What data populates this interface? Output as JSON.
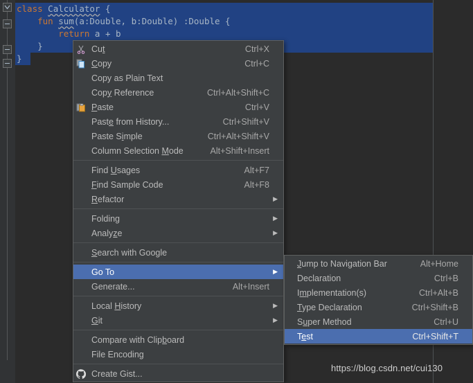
{
  "editor": {
    "lines": [
      {
        "indent": 0,
        "tokens": [
          {
            "t": "class",
            "c": "kw"
          },
          {
            "t": " ",
            "c": "punct"
          },
          {
            "t": "Calculator",
            "c": "ident squig"
          },
          {
            "t": " {",
            "c": "punct"
          }
        ]
      },
      {
        "indent": 1,
        "tokens": [
          {
            "t": "fun",
            "c": "kw"
          },
          {
            "t": " ",
            "c": "punct"
          },
          {
            "t": "sum",
            "c": "ident squig"
          },
          {
            "t": "(a:Double, b:Double) :Double {",
            "c": "punct"
          }
        ]
      },
      {
        "indent": 2,
        "tokens": [
          {
            "t": "return",
            "c": "kw"
          },
          {
            "t": " a + b",
            "c": "punct"
          }
        ]
      },
      {
        "indent": 1,
        "tokens": [
          {
            "t": "}",
            "c": "punct"
          }
        ]
      },
      {
        "indent": 0,
        "tokens": [
          {
            "t": "}",
            "c": "punct"
          }
        ]
      }
    ],
    "raw_text": "class Calculator {\n    fun sum(a:Double, b:Double) :Double {\n        return a + b\n    }\n}",
    "selection_color": "#214283",
    "background_color": "#2b2b2b",
    "keyword_color": "#cc7832",
    "identifier_color": "#a9b7c6"
  },
  "context_menu": {
    "name": "editor-context-menu",
    "highlight_color": "#4b6eaf",
    "background_color": "#3c3f41",
    "groups": [
      {
        "items": [
          {
            "label": "Cut",
            "mnemonic": "t",
            "accel": "Ctrl+X",
            "icon": "cut-icon",
            "submenu": false
          },
          {
            "label": "Copy",
            "mnemonic": "C",
            "accel": "Ctrl+C",
            "icon": "copy-icon",
            "submenu": false
          },
          {
            "label": "Copy as Plain Text",
            "mnemonic": "",
            "accel": "",
            "icon": "",
            "submenu": false
          },
          {
            "label": "Copy Reference",
            "mnemonic": "y",
            "accel": "Ctrl+Alt+Shift+C",
            "icon": "",
            "submenu": false
          },
          {
            "label": "Paste",
            "mnemonic": "P",
            "accel": "Ctrl+V",
            "icon": "paste-icon",
            "submenu": false
          },
          {
            "label": "Paste from History...",
            "mnemonic": "e",
            "accel": "Ctrl+Shift+V",
            "icon": "",
            "submenu": false
          },
          {
            "label": "Paste Simple",
            "mnemonic": "i",
            "accel": "Ctrl+Alt+Shift+V",
            "icon": "",
            "submenu": false
          },
          {
            "label": "Column Selection Mode",
            "mnemonic": "M",
            "accel": "Alt+Shift+Insert",
            "icon": "",
            "submenu": false
          }
        ]
      },
      {
        "items": [
          {
            "label": "Find Usages",
            "mnemonic": "U",
            "accel": "Alt+F7",
            "icon": "",
            "submenu": false
          },
          {
            "label": "Find Sample Code",
            "mnemonic": "F",
            "accel": "Alt+F8",
            "icon": "",
            "submenu": false
          },
          {
            "label": "Refactor",
            "mnemonic": "R",
            "accel": "",
            "icon": "",
            "submenu": true
          }
        ]
      },
      {
        "items": [
          {
            "label": "Folding",
            "mnemonic": "",
            "accel": "",
            "icon": "",
            "submenu": true
          },
          {
            "label": "Analyze",
            "mnemonic": "z",
            "accel": "",
            "icon": "",
            "submenu": true
          }
        ]
      },
      {
        "items": [
          {
            "label": "Search with Google",
            "mnemonic": "S",
            "accel": "",
            "icon": "",
            "submenu": false
          }
        ]
      },
      {
        "items": [
          {
            "label": "Go To",
            "mnemonic": "",
            "accel": "",
            "icon": "",
            "submenu": true,
            "selected": true
          },
          {
            "label": "Generate...",
            "mnemonic": "",
            "accel": "Alt+Insert",
            "icon": "",
            "submenu": false
          }
        ]
      },
      {
        "items": [
          {
            "label": "Local History",
            "mnemonic": "H",
            "accel": "",
            "icon": "",
            "submenu": true
          },
          {
            "label": "Git",
            "mnemonic": "G",
            "accel": "",
            "icon": "",
            "submenu": true
          }
        ]
      },
      {
        "items": [
          {
            "label": "Compare with Clipboard",
            "mnemonic": "b",
            "accel": "",
            "icon": "",
            "submenu": false
          },
          {
            "label": "File Encoding",
            "mnemonic": "",
            "accel": "",
            "icon": "",
            "submenu": false
          }
        ]
      },
      {
        "items": [
          {
            "label": "Create Gist...",
            "mnemonic": "",
            "accel": "",
            "icon": "github-icon",
            "submenu": false
          }
        ]
      }
    ]
  },
  "sub_menu": {
    "name": "go-to-submenu",
    "items": [
      {
        "label": "Jump to Navigation Bar",
        "mnemonic": "J",
        "accel": "Alt+Home",
        "selected": false
      },
      {
        "label": "Declaration",
        "mnemonic": "",
        "accel": "Ctrl+B",
        "selected": false
      },
      {
        "label": "Implementation(s)",
        "mnemonic": "m",
        "accel": "Ctrl+Alt+B",
        "selected": false
      },
      {
        "label": "Type Declaration",
        "mnemonic": "T",
        "accel": "Ctrl+Shift+B",
        "selected": false
      },
      {
        "label": "Super Method",
        "mnemonic": "u",
        "accel": "Ctrl+U",
        "selected": false
      },
      {
        "label": "Test",
        "mnemonic": "e",
        "accel": "Ctrl+Shift+T",
        "selected": true
      }
    ]
  },
  "watermark": {
    "text": "https://blog.csdn.net/cui130"
  }
}
